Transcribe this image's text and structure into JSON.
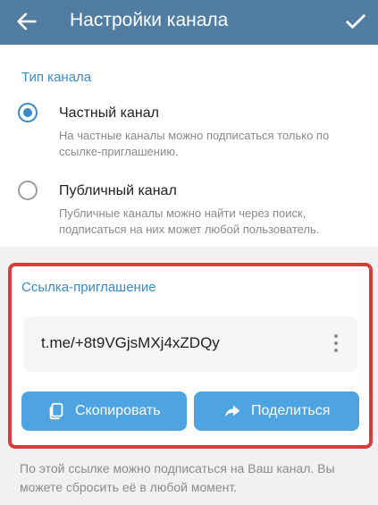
{
  "header": {
    "title": "Настройки канала",
    "back_icon": "arrow-left-icon",
    "confirm_icon": "check-icon"
  },
  "channel_type": {
    "section_title": "Тип канала",
    "options": [
      {
        "label": "Частный канал",
        "description": "На частные каналы можно подписаться только по ссылке-приглашению.",
        "selected": true
      },
      {
        "label": "Публичный канал",
        "description": "Публичные каналы можно найти через поиск, подписаться на них может любой пользователь.",
        "selected": false
      }
    ]
  },
  "invite": {
    "section_title": "Ссылка-приглашение",
    "link": "t.me/+8t9VGjsMXj4xZDQy",
    "menu_icon": "more-vertical-icon",
    "copy_label": "Скопировать",
    "copy_icon": "copy-icon",
    "share_label": "Поделиться",
    "share_icon": "share-arrow-icon",
    "highlight_color": "#d93a3a"
  },
  "footer_text": "По этой ссылке можно подписаться на Ваш канал. Вы можете сбросить её в любой момент.",
  "colors": {
    "header": "#517da2",
    "accent": "#3a8cc7",
    "button": "#4ea3e1"
  }
}
